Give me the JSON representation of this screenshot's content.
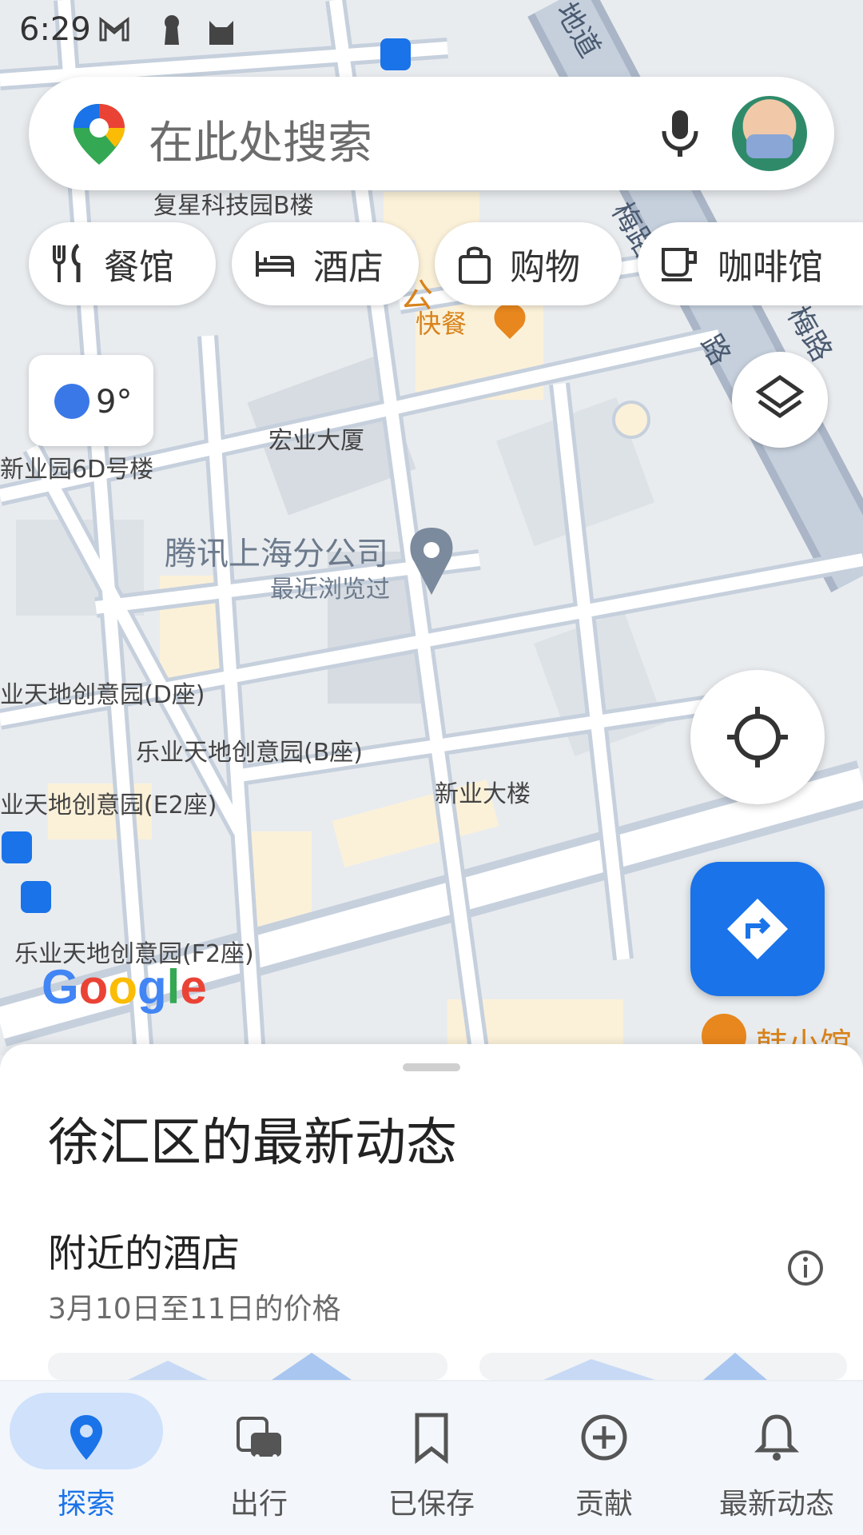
{
  "status_bar": {
    "time": "6:29",
    "icons": [
      "gmail-icon",
      "keyhole-icon",
      "cat-icon"
    ]
  },
  "search": {
    "placeholder": "在此处搜索",
    "icons": [
      "maps-pin-icon",
      "microphone-icon",
      "avatar"
    ]
  },
  "chips": [
    {
      "label": "餐馆",
      "icon": "fork-knife-icon"
    },
    {
      "label": "酒店",
      "icon": "bed-icon"
    },
    {
      "label": "购物",
      "icon": "shopping-bag-icon"
    },
    {
      "label": "咖啡馆",
      "icon": "coffee-cup-icon"
    }
  ],
  "weather": {
    "temp": "9°"
  },
  "map": {
    "labels": {
      "fuxing": "复星科技园B楼",
      "fastfood": "快餐",
      "hongye": "宏业大厦",
      "xinye6d": "新业园6D号楼",
      "tencent": "腾讯上海分公司",
      "recent": "最近浏览过",
      "leye_d": "业天地创意园(D座)",
      "leye_b": "乐业天地创意园(B座)",
      "xinye": "新业大楼",
      "leye_e2": "业天地创意园(E2座)",
      "leye_f2": "乐业天地创意园(F2座)",
      "hanxiaoguan": "韩小馆",
      "road_top": "地道",
      "road_right1": "梅路",
      "road_right2": "路",
      "road_right3": "梅路",
      "partial_orange": "公"
    },
    "google_logo": [
      "G",
      "o",
      "o",
      "g",
      "l",
      "e"
    ]
  },
  "sheet": {
    "title": "徐汇区的最新动态",
    "subtitle": "附近的酒店",
    "caption": "3月10日至11日的价格"
  },
  "nav": [
    {
      "label": "探索",
      "icon": "location-pin-icon",
      "active": true
    },
    {
      "label": "出行",
      "icon": "transit-icon",
      "active": false
    },
    {
      "label": "已保存",
      "icon": "bookmark-icon",
      "active": false
    },
    {
      "label": "贡献",
      "icon": "add-circle-icon",
      "active": false
    },
    {
      "label": "最新动态",
      "icon": "bell-icon",
      "active": false
    }
  ],
  "colors": {
    "accent": "#1a73e8",
    "map_road": "#ffffff",
    "map_block": "#dfe3e8",
    "orange_poi": "#e8871e"
  }
}
